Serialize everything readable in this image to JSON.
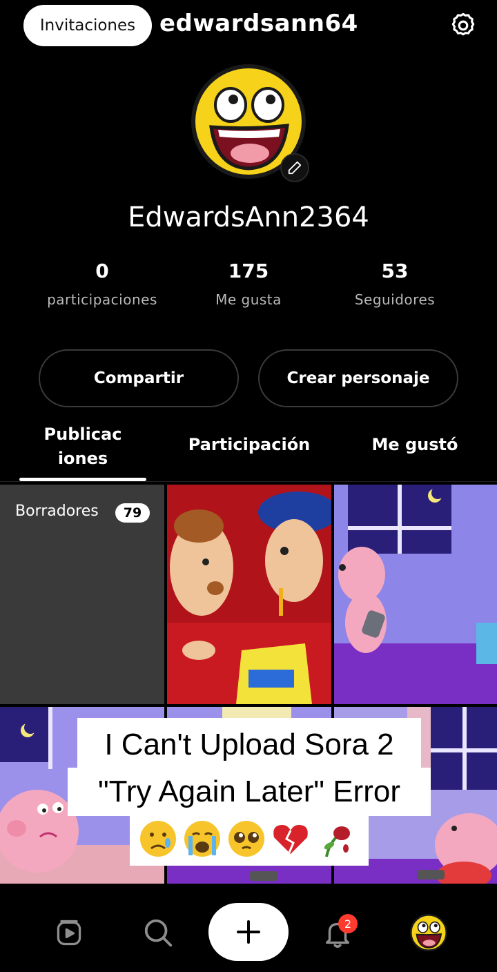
{
  "header": {
    "invitations_label": "Invitaciones",
    "username": "edwardsann64",
    "settings_icon": "gear-icon"
  },
  "profile": {
    "avatar_icon": "awesome-face-avatar",
    "edit_icon": "pencil-icon",
    "display_name": "EdwardsAnn2364"
  },
  "stats": [
    {
      "value": "0",
      "label": "participaciones"
    },
    {
      "value": "175",
      "label": "Me gusta"
    },
    {
      "value": "53",
      "label": "Seguidores"
    }
  ],
  "actions": {
    "share_label": "Compartir",
    "create_character_label": "Crear personaje"
  },
  "tabs": [
    {
      "label": "Publicac\niones",
      "active": true
    },
    {
      "label": "Participación",
      "active": false
    },
    {
      "label": "Me gustó",
      "active": false
    }
  ],
  "grid": {
    "drafts_label": "Borradores",
    "drafts_count": "79"
  },
  "overlay_caption": {
    "line1": "I Can't Upload Sora 2",
    "line2": "\"Try Again Later\" Error",
    "emojis": [
      "😢",
      "😭",
      "🥺",
      "💔",
      "🥀"
    ]
  },
  "bottom_nav": {
    "feed_icon": "play-icon",
    "search_icon": "search-icon",
    "create_icon": "plus-icon",
    "notifications_icon": "bell-icon",
    "notifications_count": "2",
    "profile_icon": "awesome-face-avatar"
  },
  "colors": {
    "background": "#000000",
    "avatar_yellow": "#f6d21a",
    "badge_red": "#ff3b30",
    "drafts_tile": "#3a3a3a"
  }
}
